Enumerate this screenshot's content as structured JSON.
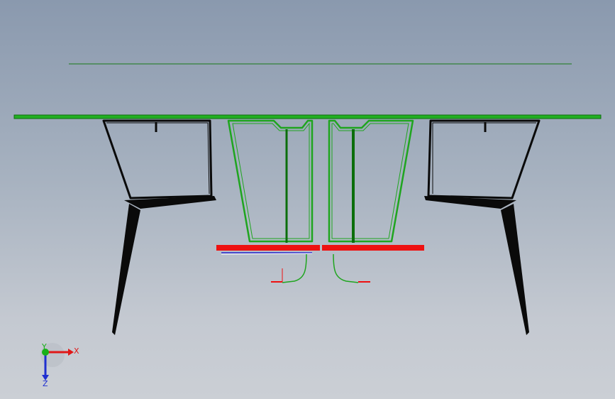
{
  "scene": {
    "background_top": "#8a99ae",
    "background_bottom": "#cbcfd5",
    "edge_colors": {
      "selected_green": "#1fa51f",
      "dark_green": "#0b6e0b",
      "red": "#ee1111",
      "black": "#0a0a0a",
      "blue": "#2222cc"
    }
  },
  "triad": {
    "x_label": "X",
    "y_label": "Y",
    "z_label": "Z",
    "x_color": "#e01818",
    "y_color": "#18b018",
    "z_color": "#2030d0"
  }
}
